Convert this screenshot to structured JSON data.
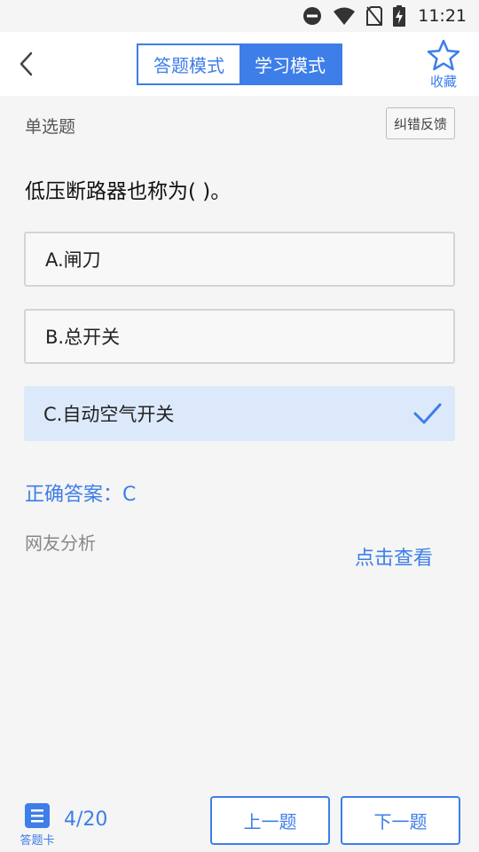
{
  "status_bar": {
    "time": "11:21",
    "icons": [
      "do-not-disturb-icon",
      "wifi-icon",
      "no-sim-icon",
      "battery-charging-icon"
    ]
  },
  "header": {
    "back_icon": "chevron-left-icon",
    "tabs": [
      {
        "label": "答题模式",
        "active": false
      },
      {
        "label": "学习模式",
        "active": true
      }
    ],
    "favorite": {
      "icon": "star-icon",
      "label": "收藏"
    }
  },
  "question": {
    "type": "单选题",
    "feedback_label": "纠错反馈",
    "text": "低压断路器也称为( )。",
    "options": [
      {
        "label": "A.闸刀",
        "selected": false
      },
      {
        "label": "B.总开关",
        "selected": false
      },
      {
        "label": "C.自动空气开关",
        "selected": true
      }
    ],
    "selected_icon": "checkmark-icon"
  },
  "answer": {
    "text": "正确答案：C"
  },
  "analysis": {
    "label": "网友分析",
    "view_link": "点击查看"
  },
  "footer": {
    "card_icon": "list-icon",
    "card_label": "答题卡",
    "progress": "4/20",
    "prev_label": "上一题",
    "next_label": "下一题"
  },
  "colors": {
    "accent": "#3d7ee8",
    "selected_bg": "#dbe9fb",
    "background": "#f5f5f5"
  }
}
